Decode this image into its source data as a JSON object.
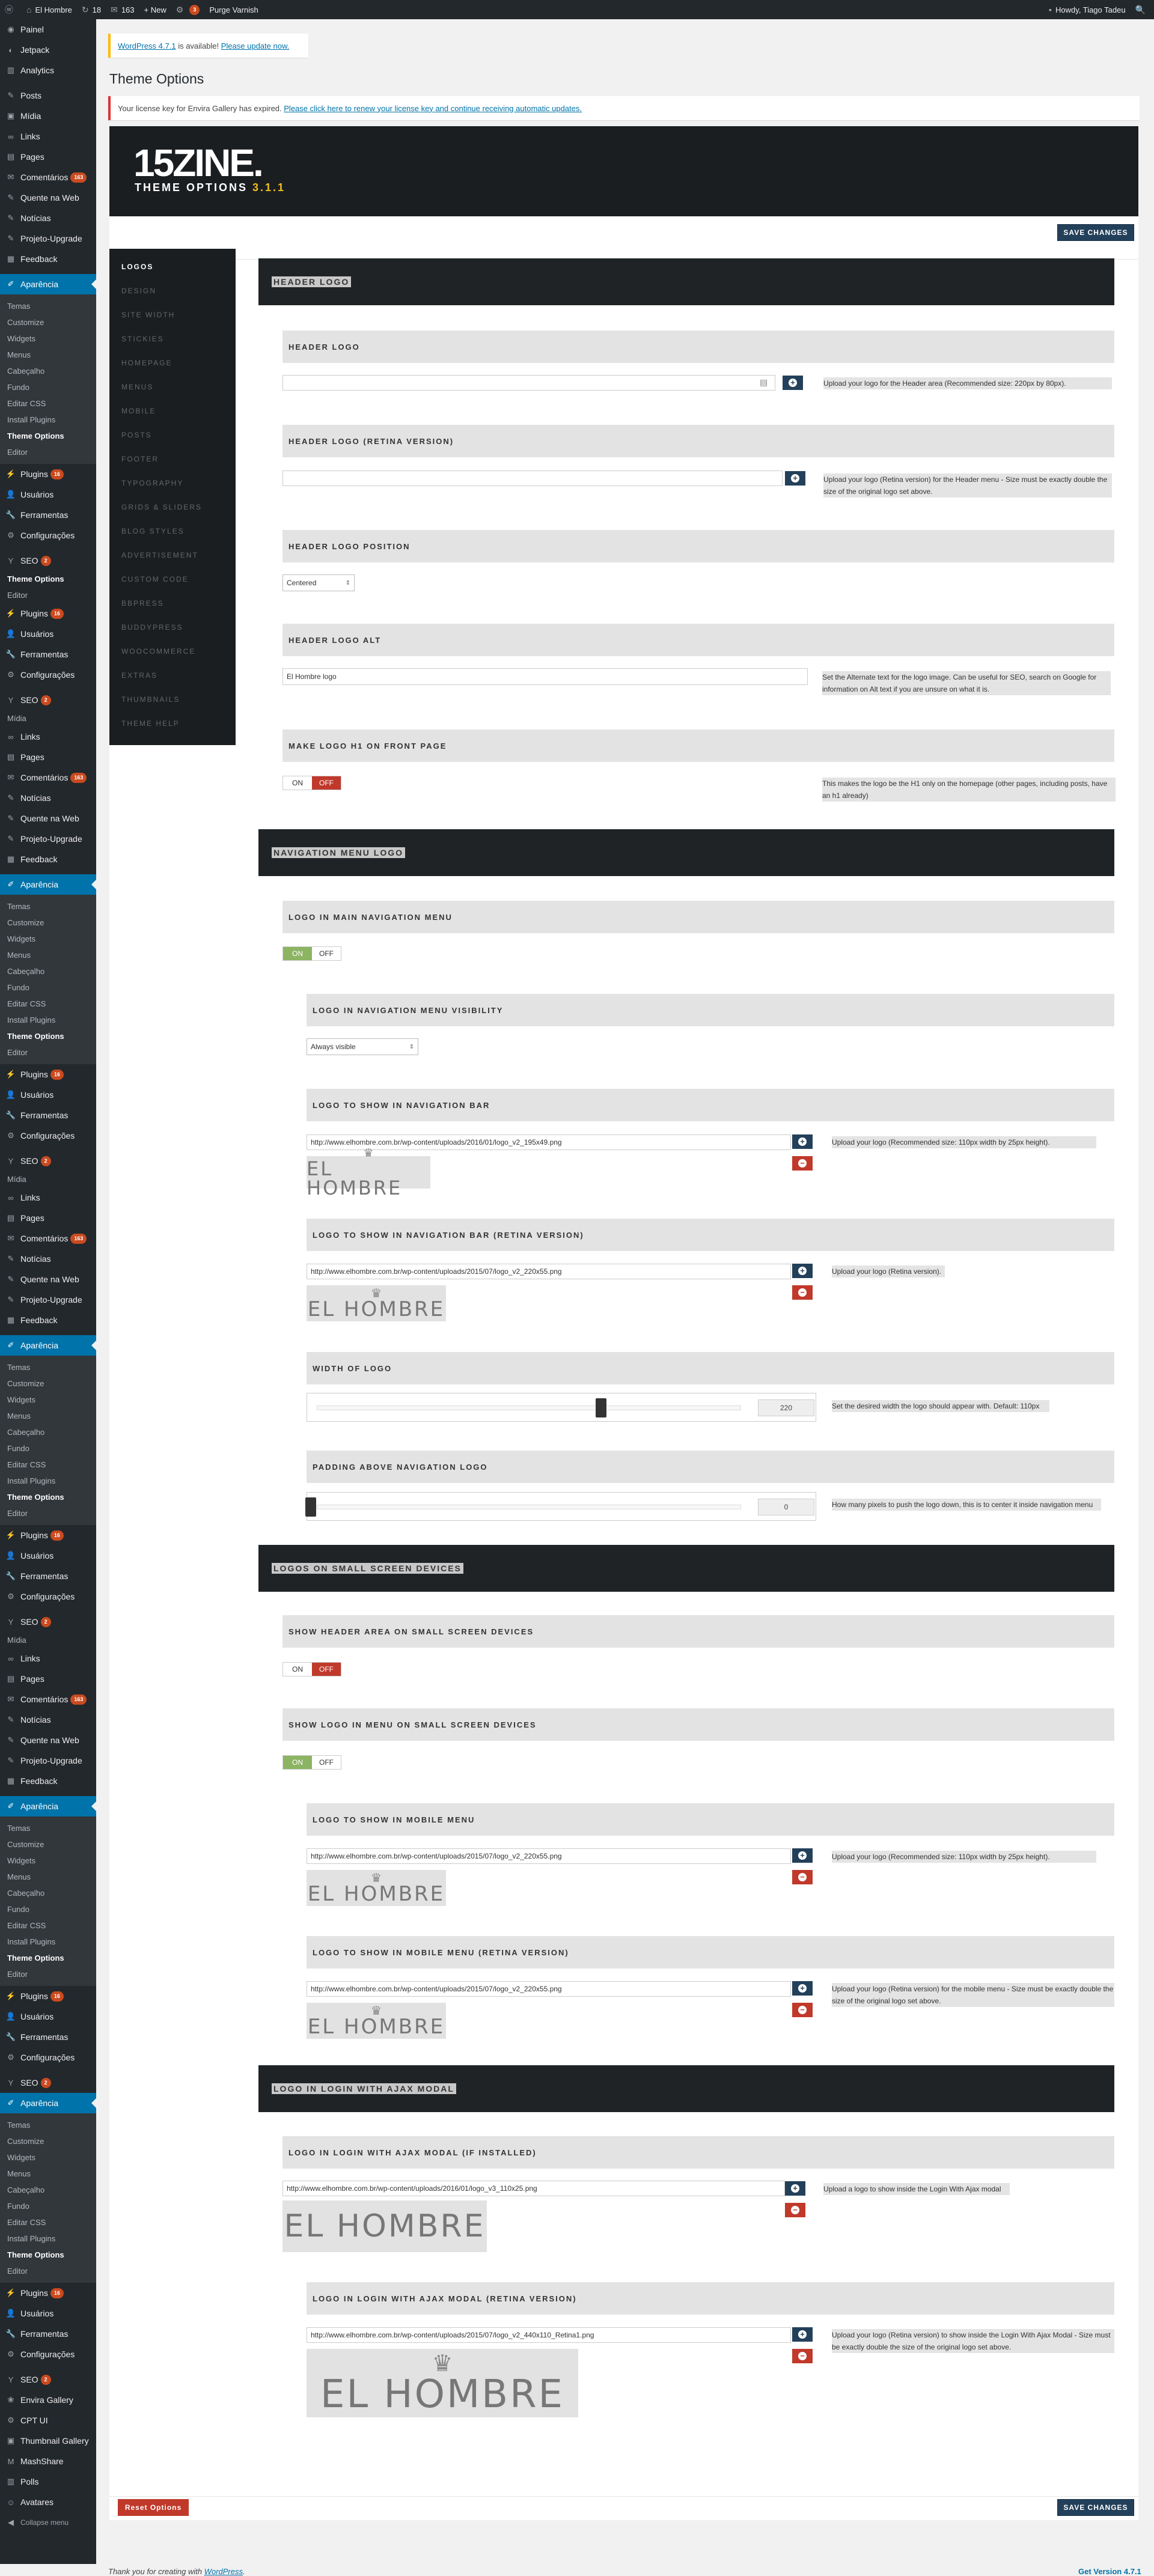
{
  "adminbar": {
    "site": "El Hombre",
    "updates": "18",
    "comments": "163",
    "new": "+ New",
    "plugin_count": "3",
    "purge": "Purge Varnish",
    "howdy": "Howdy, Tiago Tadeu"
  },
  "sidebar": [
    {
      "t": "i",
      "label": "Painel",
      "icon": "dashboard-icon",
      "g": "◉"
    },
    {
      "t": "i",
      "label": "Jetpack",
      "icon": "jetpack-icon",
      "g": "◐"
    },
    {
      "t": "i",
      "label": "Analytics",
      "icon": "analytics-icon",
      "g": "▥"
    },
    {
      "t": "gap"
    },
    {
      "t": "i",
      "label": "Posts",
      "icon": "pin-icon",
      "g": "✎"
    },
    {
      "t": "i",
      "label": "Mídia",
      "icon": "media-icon",
      "g": "▣"
    },
    {
      "t": "i",
      "label": "Links",
      "icon": "link-icon",
      "g": "∞"
    },
    {
      "t": "i",
      "label": "Pages",
      "icon": "pages-icon",
      "g": "▤"
    },
    {
      "t": "i",
      "label": "Comentários",
      "icon": "comments-icon",
      "g": "✉",
      "badge": "163"
    },
    {
      "t": "i",
      "label": "Quente na Web",
      "icon": "pin-icon",
      "g": "✎"
    },
    {
      "t": "i",
      "label": "Notícias",
      "icon": "pin-icon",
      "g": "✎"
    },
    {
      "t": "i",
      "label": "Projeto-Upgrade",
      "icon": "pin-icon",
      "g": "✎"
    },
    {
      "t": "i",
      "label": "Feedback",
      "icon": "feedback-icon",
      "g": "▦"
    },
    {
      "t": "gap"
    },
    {
      "t": "cur",
      "label": "Aparência",
      "icon": "brush-icon",
      "g": "✐"
    },
    {
      "t": "sub",
      "items": [
        "Temas",
        "Customize",
        "Widgets",
        "Menus",
        "Cabeçalho",
        "Fundo",
        "Editar CSS",
        "Install Plugins",
        "Theme Options",
        "Editor"
      ],
      "on": 8
    },
    {
      "t": "i",
      "label": "Plugins",
      "icon": "plugins-icon",
      "g": "⚡",
      "badge": "16"
    },
    {
      "t": "i",
      "label": "Usuários",
      "icon": "users-icon",
      "g": "👤"
    },
    {
      "t": "i",
      "label": "Ferramentas",
      "icon": "tools-icon",
      "g": "🔧"
    },
    {
      "t": "i",
      "label": "Configurações",
      "icon": "settings-icon",
      "g": "⚙"
    },
    {
      "t": "gap"
    },
    {
      "t": "i",
      "label": "SEO",
      "icon": "seo-icon",
      "g": "Y",
      "badge": "2"
    },
    {
      "t": "s",
      "label": "Theme Options",
      "on": true
    },
    {
      "t": "s",
      "label": "Editor"
    },
    {
      "t": "i",
      "label": "Plugins",
      "icon": "plugins-icon",
      "g": "⚡",
      "badge": "16"
    },
    {
      "t": "i",
      "label": "Usuários",
      "icon": "users-icon",
      "g": "👤"
    },
    {
      "t": "i",
      "label": "Ferramentas",
      "icon": "tools-icon",
      "g": "🔧"
    },
    {
      "t": "i",
      "label": "Configurações",
      "icon": "settings-icon",
      "g": "⚙"
    },
    {
      "t": "gap"
    },
    {
      "t": "i",
      "label": "SEO",
      "icon": "seo-icon",
      "g": "Y",
      "badge": "2"
    },
    {
      "t": "s",
      "label": "Mídia"
    },
    {
      "t": "i",
      "label": "Links",
      "icon": "link-icon",
      "g": "∞"
    },
    {
      "t": "i",
      "label": "Pages",
      "icon": "pages-icon",
      "g": "▤"
    },
    {
      "t": "i",
      "label": "Comentários",
      "icon": "comments-icon",
      "g": "✉",
      "badge": "163"
    },
    {
      "t": "i",
      "label": "Notícias",
      "icon": "pin-icon",
      "g": "✎"
    },
    {
      "t": "i",
      "label": "Quente na Web",
      "icon": "pin-icon",
      "g": "✎"
    },
    {
      "t": "i",
      "label": "Projeto-Upgrade",
      "icon": "pin-icon",
      "g": "✎"
    },
    {
      "t": "i",
      "label": "Feedback",
      "icon": "feedback-icon",
      "g": "▦"
    },
    {
      "t": "gap"
    },
    {
      "t": "cur",
      "label": "Aparência",
      "icon": "brush-icon",
      "g": "✐"
    },
    {
      "t": "sub",
      "items": [
        "Temas",
        "Customize",
        "Widgets",
        "Menus",
        "Cabeçalho",
        "Fundo",
        "Editar CSS",
        "Install Plugins",
        "Theme Options",
        "Editor"
      ],
      "on": 8
    },
    {
      "t": "i",
      "label": "Plugins",
      "icon": "plugins-icon",
      "g": "⚡",
      "badge": "16"
    },
    {
      "t": "i",
      "label": "Usuários",
      "icon": "users-icon",
      "g": "👤"
    },
    {
      "t": "i",
      "label": "Ferramentas",
      "icon": "tools-icon",
      "g": "🔧"
    },
    {
      "t": "i",
      "label": "Configurações",
      "icon": "settings-icon",
      "g": "⚙"
    },
    {
      "t": "gap"
    },
    {
      "t": "i",
      "label": "SEO",
      "icon": "seo-icon",
      "g": "Y",
      "badge": "2"
    },
    {
      "t": "s",
      "label": "Mídia"
    },
    {
      "t": "i",
      "label": "Links",
      "icon": "link-icon",
      "g": "∞"
    },
    {
      "t": "i",
      "label": "Pages",
      "icon": "pages-icon",
      "g": "▤"
    },
    {
      "t": "i",
      "label": "Comentários",
      "icon": "comments-icon",
      "g": "✉",
      "badge": "163"
    },
    {
      "t": "i",
      "label": "Notícias",
      "icon": "pin-icon",
      "g": "✎"
    },
    {
      "t": "i",
      "label": "Quente na Web",
      "icon": "pin-icon",
      "g": "✎"
    },
    {
      "t": "i",
      "label": "Projeto-Upgrade",
      "icon": "pin-icon",
      "g": "✎"
    },
    {
      "t": "i",
      "label": "Feedback",
      "icon": "feedback-icon",
      "g": "▦"
    },
    {
      "t": "gap"
    },
    {
      "t": "cur",
      "label": "Aparência",
      "icon": "brush-icon",
      "g": "✐"
    },
    {
      "t": "sub",
      "items": [
        "Temas",
        "Customize",
        "Widgets",
        "Menus",
        "Cabeçalho",
        "Fundo",
        "Editar CSS",
        "Install Plugins",
        "Theme Options",
        "Editor"
      ],
      "on": 8
    },
    {
      "t": "i",
      "label": "Plugins",
      "icon": "plugins-icon",
      "g": "⚡",
      "badge": "16"
    },
    {
      "t": "i",
      "label": "Usuários",
      "icon": "users-icon",
      "g": "👤"
    },
    {
      "t": "i",
      "label": "Ferramentas",
      "icon": "tools-icon",
      "g": "🔧"
    },
    {
      "t": "i",
      "label": "Configurações",
      "icon": "settings-icon",
      "g": "⚙"
    },
    {
      "t": "gap"
    },
    {
      "t": "i",
      "label": "SEO",
      "icon": "seo-icon",
      "g": "Y",
      "badge": "2"
    },
    {
      "t": "s",
      "label": "Mídia"
    },
    {
      "t": "i",
      "label": "Links",
      "icon": "link-icon",
      "g": "∞"
    },
    {
      "t": "i",
      "label": "Pages",
      "icon": "pages-icon",
      "g": "▤"
    },
    {
      "t": "i",
      "label": "Comentários",
      "icon": "comments-icon",
      "g": "✉",
      "badge": "163"
    },
    {
      "t": "i",
      "label": "Notícias",
      "icon": "pin-icon",
      "g": "✎"
    },
    {
      "t": "i",
      "label": "Quente na Web",
      "icon": "pin-icon",
      "g": "✎"
    },
    {
      "t": "i",
      "label": "Projeto-Upgrade",
      "icon": "pin-icon",
      "g": "✎"
    },
    {
      "t": "i",
      "label": "Feedback",
      "icon": "feedback-icon",
      "g": "▦"
    },
    {
      "t": "gap"
    },
    {
      "t": "cur",
      "label": "Aparência",
      "icon": "brush-icon",
      "g": "✐"
    },
    {
      "t": "sub",
      "items": [
        "Temas",
        "Customize",
        "Widgets",
        "Menus",
        "Cabeçalho",
        "Fundo",
        "Editar CSS",
        "Install Plugins",
        "Theme Options",
        "Editor"
      ],
      "on": 8
    },
    {
      "t": "i",
      "label": "Plugins",
      "icon": "plugins-icon",
      "g": "⚡",
      "badge": "16"
    },
    {
      "t": "i",
      "label": "Usuários",
      "icon": "users-icon",
      "g": "👤"
    },
    {
      "t": "i",
      "label": "Ferramentas",
      "icon": "tools-icon",
      "g": "🔧"
    },
    {
      "t": "i",
      "label": "Configurações",
      "icon": "settings-icon",
      "g": "⚙"
    },
    {
      "t": "gap"
    },
    {
      "t": "i",
      "label": "SEO",
      "icon": "seo-icon",
      "g": "Y",
      "badge": "2"
    },
    {
      "t": "cur",
      "label": "Aparência",
      "icon": "brush-icon",
      "g": "✐"
    },
    {
      "t": "sub",
      "items": [
        "Temas",
        "Customize",
        "Widgets",
        "Menus",
        "Cabeçalho",
        "Fundo",
        "Editar CSS",
        "Install Plugins",
        "Theme Options",
        "Editor"
      ],
      "on": 8
    },
    {
      "t": "i",
      "label": "Plugins",
      "icon": "plugins-icon",
      "g": "⚡",
      "badge": "16"
    },
    {
      "t": "i",
      "label": "Usuários",
      "icon": "users-icon",
      "g": "👤"
    },
    {
      "t": "i",
      "label": "Ferramentas",
      "icon": "tools-icon",
      "g": "🔧"
    },
    {
      "t": "i",
      "label": "Configurações",
      "icon": "settings-icon",
      "g": "⚙"
    },
    {
      "t": "gap"
    },
    {
      "t": "i",
      "label": "SEO",
      "icon": "seo-icon",
      "g": "Y",
      "badge": "2"
    },
    {
      "t": "i",
      "label": "Envira Gallery",
      "icon": "gallery-icon",
      "g": "❀"
    },
    {
      "t": "i",
      "label": "CPT UI",
      "icon": "cpt-icon",
      "g": "⚙"
    },
    {
      "t": "i",
      "label": "Thumbnail Gallery",
      "icon": "gallery-icon",
      "g": "▣"
    },
    {
      "t": "i",
      "label": "MashShare",
      "icon": "share-icon",
      "g": "M"
    },
    {
      "t": "i",
      "label": "Polls",
      "icon": "polls-icon",
      "g": "▥"
    },
    {
      "t": "i",
      "label": "Avatares",
      "icon": "avatar-icon",
      "g": "☺"
    },
    {
      "t": "i",
      "label": "Collapse menu",
      "icon": "collapse-icon",
      "g": "◀",
      "small": true
    }
  ],
  "notices": {
    "update_link": "WordPress 4.7.1",
    "update_mid": " is available! ",
    "update_cta": "Please update now.",
    "license_text": "Your license key for Envira Gallery has expired. ",
    "license_link": "Please click here to renew your license key and continue receiving automatic updates."
  },
  "page_title": "Theme Options",
  "brand": {
    "logo": "15ZINE.",
    "sub": "THEME OPTIONS",
    "version": "3.1.1"
  },
  "buttons": {
    "save": "SAVE CHANGES",
    "reset": "Reset Options"
  },
  "tabs": [
    "LOGOS",
    "DESIGN",
    "SITE WIDTH",
    "STICKIES",
    "HOMEPAGE",
    "MENUS",
    "MOBILE",
    "POSTS",
    "FOOTER",
    "TYPOGRAPHY",
    "GRIDS & SLIDERS",
    "BLOG STYLES",
    "ADVERTISEMENT",
    "CUSTOM CODE",
    "BBPRESS",
    "BUDDYPRESS",
    "WOOCOMMERCE",
    "EXTRAS",
    "THUMBNAILS",
    "THEME HELP"
  ],
  "sections": [
    "HEADER LOGO",
    "NAVIGATION MENU LOGO",
    "LOGOS ON SMALL SCREEN DEVICES",
    "LOGO IN LOGIN WITH AJAX MODAL"
  ],
  "fields": {
    "header_logo": {
      "label": "HEADER LOGO",
      "value": "",
      "desc": "Upload your logo for the Header area (Recommended size: 220px by 80px)."
    },
    "header_logo_retina": {
      "label": "HEADER LOGO (RETINA VERSION)",
      "value": "",
      "desc": "Upload your logo (Retina version) for the Header menu - Size must be exactly double the size of the original logo set above."
    },
    "header_logo_position": {
      "label": "HEADER LOGO POSITION",
      "value": "Centered"
    },
    "header_logo_alt": {
      "label": "HEADER LOGO ALT",
      "value": "El Hombre logo",
      "desc": "Set the Alternate text for the logo image. Can be useful for SEO, search on Google for information on Alt text if you are unsure on what it is."
    },
    "logo_h1": {
      "label": "MAKE LOGO H1 ON FRONT PAGE",
      "on": "ON",
      "off": "OFF",
      "desc": "This makes the logo be the H1 only on the homepage (other pages, including posts, have an h1 already)"
    },
    "nav_logo": {
      "label": "LOGO IN MAIN NAVIGATION MENU",
      "on": "ON",
      "off": "OFF"
    },
    "nav_vis": {
      "label": "LOGO IN NAVIGATION MENU VISIBILITY",
      "value": "Always visible"
    },
    "nav_bar_logo": {
      "label": "LOGO TO SHOW IN NAVIGATION BAR",
      "value": "http://www.elhombre.com.br/wp-content/uploads/2016/01/logo_v2_195x49.png",
      "desc": "Upload your logo (Recommended size: 110px width by 25px height)."
    },
    "nav_bar_logo_retina": {
      "label": "LOGO TO SHOW IN NAVIGATION BAR (RETINA VERSION)",
      "value": "http://www.elhombre.com.br/wp-content/uploads/2015/07/logo_v2_220x55.png",
      "desc": "Upload your logo (Retina version)."
    },
    "logo_width": {
      "label": "WIDTH OF LOGO",
      "value": "220",
      "fraction": 0.67,
      "desc": "Set the desired width the logo should appear with. Default: 110px"
    },
    "logo_padding": {
      "label": "PADDING ABOVE NAVIGATION LOGO",
      "value": "0",
      "fraction": 0,
      "desc": "How many pixels to push the logo down, this is to center it inside navigation menu"
    },
    "small_header": {
      "label": "SHOW HEADER AREA ON SMALL SCREEN DEVICES",
      "on": "ON",
      "off": "OFF"
    },
    "small_menu_logo": {
      "label": "SHOW LOGO IN MENU ON SMALL SCREEN DEVICES",
      "on": "ON",
      "off": "OFF"
    },
    "mobile_logo": {
      "label": "LOGO TO SHOW IN MOBILE MENU",
      "value": "http://www.elhombre.com.br/wp-content/uploads/2015/07/logo_v2_220x55.png",
      "desc": "Upload your logo (Recommended size: 110px width by 25px height)."
    },
    "mobile_logo_retina": {
      "label": "LOGO TO SHOW IN MOBILE MENU (RETINA VERSION)",
      "value": "http://www.elhombre.com.br/wp-content/uploads/2015/07/logo_v2_220x55.png",
      "desc": "Upload your logo (Retina version) for the mobile menu - Size must be exactly double the size of the original logo set above."
    },
    "login_logo": {
      "label": "LOGO IN LOGIN WITH AJAX MODAL (IF INSTALLED)",
      "value": "http://www.elhombre.com.br/wp-content/uploads/2016/01/logo_v3_110x25.png",
      "desc": "Upload a logo to show inside the Login With Ajax modal"
    },
    "login_logo_retina": {
      "label": "LOGO IN LOGIN WITH AJAX MODAL (RETINA VERSION)",
      "value": "http://www.elhombre.com.br/wp-content/uploads/2015/07/logo_v2_440x110_Retina1.png",
      "desc": "Upload your logo (Retina version) to show inside the Login With Ajax Modal - Size must be exactly double the size of the original logo set above."
    }
  },
  "preview_text": "EL HOMBRE",
  "footer": {
    "thanks": "Thank you for creating with ",
    "wp": "WordPress",
    "version": "Get Version 4.7.1"
  }
}
